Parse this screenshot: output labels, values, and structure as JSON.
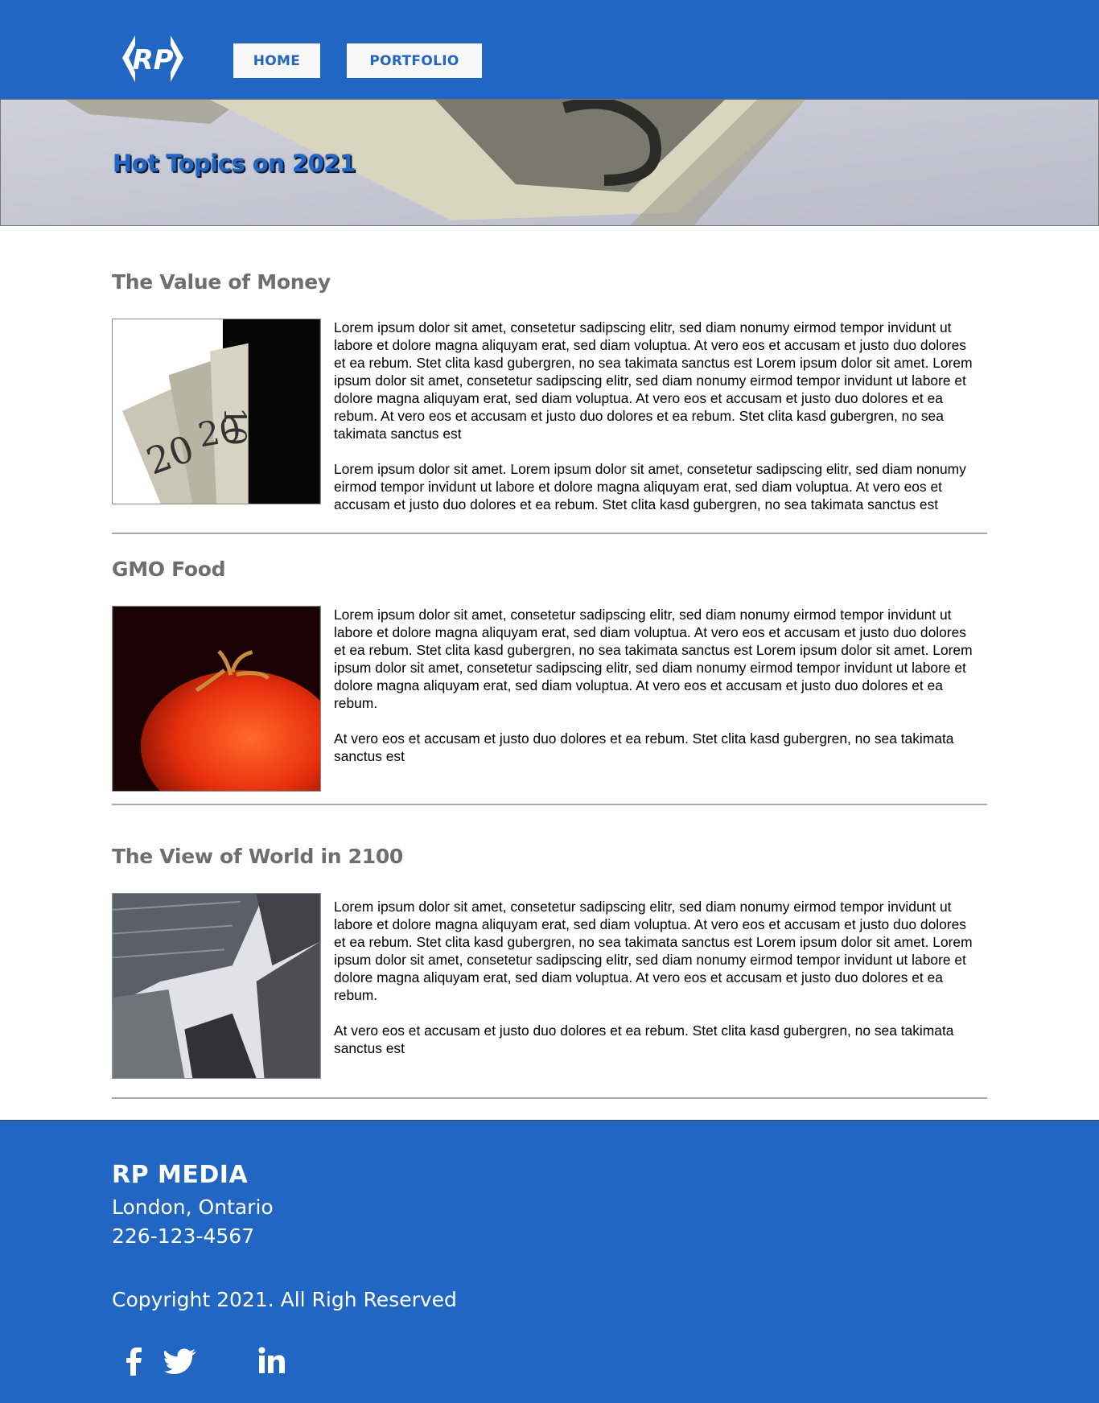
{
  "header": {
    "logo_text": "RP",
    "nav": [
      {
        "label": "HOME"
      },
      {
        "label": "PORTFOLIO"
      }
    ],
    "brand_color": "#2166c2"
  },
  "hero": {
    "title": "Hot Topics on 2021",
    "background": "dollar-bill-photo"
  },
  "articles": [
    {
      "title": "The Value of Money",
      "image": "dollar-bills-in-wallet-photo",
      "paragraphs": [
        "Lorem ipsum dolor sit amet, consetetur sadipscing elitr, sed diam nonumy eirmod tempor invidunt ut labore et dolore magna aliquyam erat, sed diam voluptua. At vero eos et accusam et justo duo dolores et ea rebum. Stet clita kasd gubergren, no sea takimata sanctus est Lorem ipsum dolor sit amet. Lorem ipsum dolor sit amet, consetetur sadipscing elitr, sed diam nonumy eirmod tempor invidunt ut labore et dolore magna aliquyam erat, sed diam voluptua. At vero eos et accusam et justo duo dolores et ea rebum. At vero eos et accusam et justo duo dolores et ea rebum. Stet clita kasd gubergren, no sea takimata sanctus est",
        "Lorem ipsum dolor sit amet. Lorem ipsum dolor sit amet, consetetur sadipscing elitr, sed diam nonumy eirmod tempor invidunt ut labore et dolore magna aliquyam erat, sed diam voluptua. At vero eos et accusam et justo duo dolores et ea rebum. Stet clita kasd gubergren, no sea takimata sanctus est"
      ]
    },
    {
      "title": "GMO Food",
      "image": "red-tomato-photo",
      "paragraphs": [
        "Lorem ipsum dolor sit amet, consetetur sadipscing elitr, sed diam nonumy eirmod tempor invidunt ut labore et dolore magna aliquyam erat, sed diam voluptua. At vero eos et accusam et justo duo dolores et ea rebum. Stet clita kasd gubergren, no sea takimata sanctus est Lorem ipsum dolor sit amet. Lorem ipsum dolor sit amet, consetetur sadipscing elitr, sed diam nonumy eirmod tempor invidunt ut labore et dolore magna aliquyam erat, sed diam voluptua. At vero eos et accusam et justo duo dolores et ea rebum.",
        "At vero eos et accusam et justo duo dolores et ea rebum. Stet clita kasd gubergren, no sea takimata sanctus est"
      ]
    },
    {
      "title": "The View of World in 2100",
      "image": "skyscrapers-from-below-photo",
      "paragraphs": [
        "Lorem ipsum dolor sit amet, consetetur sadipscing elitr, sed diam nonumy eirmod tempor invidunt ut labore et dolore magna aliquyam erat, sed diam voluptua. At vero eos et accusam et justo duo dolores et ea rebum. Stet clita kasd gubergren, no sea takimata sanctus est Lorem ipsum dolor sit amet. Lorem ipsum dolor sit amet, consetetur sadipscing elitr, sed diam nonumy eirmod tempor invidunt ut labore et dolore magna aliquyam erat, sed diam voluptua. At vero eos et accusam et justo duo dolores et ea rebum.",
        "At vero eos et accusam et justo duo dolores et ea rebum. Stet clita kasd gubergren, no sea takimata sanctus est"
      ]
    }
  ],
  "footer": {
    "brand": "RP MEDIA",
    "city": "London, Ontario",
    "phone": "226-123-4567",
    "copyright": "Copyright 2021. All Righ Reserved",
    "social": [
      {
        "icon": "facebook-icon"
      },
      {
        "icon": "twitter-icon"
      },
      {
        "icon": "linkedin-icon"
      }
    ]
  }
}
